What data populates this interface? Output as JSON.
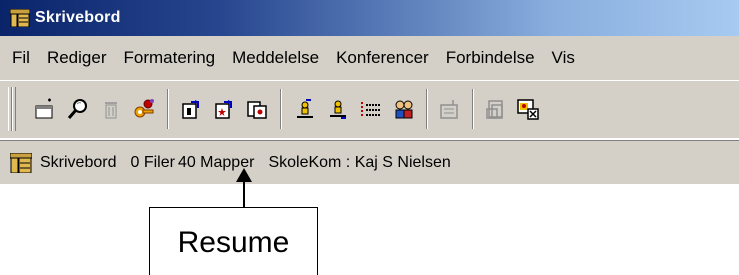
{
  "window": {
    "title": "Skrivebord"
  },
  "menu": {
    "items": [
      "Fil",
      "Rediger",
      "Formatering",
      "Meddelelse",
      "Konferencer",
      "Forbindelse",
      "Vis"
    ]
  },
  "toolbar": {
    "buttons": [
      {
        "icon": "new-message-icon"
      },
      {
        "icon": "search-icon"
      },
      {
        "icon": "trash-icon"
      },
      {
        "icon": "keys-icon"
      },
      {
        "icon": "doc-arrow-icon"
      },
      {
        "icon": "doc-star-arrow-icon"
      },
      {
        "icon": "doc-card-icon"
      },
      {
        "icon": "person-up-icon"
      },
      {
        "icon": "person-down-icon"
      },
      {
        "icon": "list-icon"
      },
      {
        "icon": "people-icon"
      },
      {
        "icon": "disabled-mail-icon"
      },
      {
        "icon": "disabled-folders-icon"
      },
      {
        "icon": "image-remove-icon"
      }
    ]
  },
  "statusbar": {
    "location": "Skrivebord",
    "files": "0 Filer",
    "folders": "40 Mapper",
    "user": "SkoleKom : Kaj S Nielsen"
  },
  "callout": {
    "label": "Resume"
  },
  "colors": {
    "title_start": "#0a246a",
    "title_end": "#a6caf0",
    "chrome": "#d4d0c8"
  }
}
